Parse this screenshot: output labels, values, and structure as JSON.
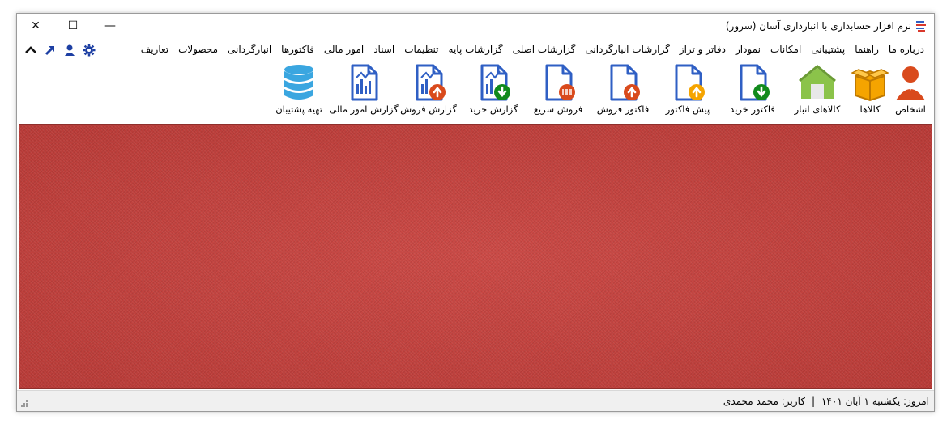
{
  "window": {
    "title": "نرم افزار حسابداری با انبارداری آسان (سرور)",
    "close_glyph": "✕",
    "maximize_glyph": "☐",
    "minimize_glyph": "—"
  },
  "menu": {
    "items": [
      {
        "label": "تعاریف"
      },
      {
        "label": "محصولات"
      },
      {
        "label": "انبارگردانی"
      },
      {
        "label": "فاکتورها"
      },
      {
        "label": "امور مالی"
      },
      {
        "label": "اسناد"
      },
      {
        "label": "تنظیمات"
      },
      {
        "label": "گزارشات پایه"
      },
      {
        "label": "گزارشات اصلی"
      },
      {
        "label": "گزارشات انبارگردانی"
      },
      {
        "label": "دفاتر و تراز"
      },
      {
        "label": "نمودار"
      },
      {
        "label": "امکانات"
      },
      {
        "label": "پشتیبانی"
      },
      {
        "label": "راهنما"
      },
      {
        "label": "درباره ما"
      }
    ],
    "tools": [
      "gear-icon",
      "user-icon",
      "arrow-up-right-icon",
      "chevron-up-icon"
    ]
  },
  "toolbar": {
    "items": [
      {
        "label": "اشخاص",
        "icon": "person-icon"
      },
      {
        "label": "کالاها",
        "icon": "box-icon"
      },
      {
        "label": "کالاهای انبار",
        "icon": "warehouse-icon"
      },
      {
        "label": "فاکتور خرید",
        "icon": "invoice-down-icon"
      },
      {
        "label": "پیش فاکتور",
        "icon": "proforma-icon"
      },
      {
        "label": "فاکتور فروش",
        "icon": "invoice-up-icon"
      },
      {
        "label": "فروش سریع",
        "icon": "barcode-doc-icon"
      },
      {
        "label": "گزارش خرید",
        "icon": "report-down-icon"
      },
      {
        "label": "گزارش فروش",
        "icon": "report-up-icon"
      },
      {
        "label": "گزارش امور مالی",
        "icon": "report-chart-icon"
      },
      {
        "label": "تهیه پشتیبان",
        "icon": "database-icon"
      }
    ]
  },
  "status": {
    "date": "امروز: یکشنبه ۱ آبان ۱۴۰۱",
    "separator": "|",
    "user": "کاربر: محمد محمدی"
  },
  "colors": {
    "background": "#c8403c",
    "icon_blue": "#2f5fc4",
    "orange": "#f5a400",
    "green": "#118a1c",
    "red": "#d94a1c"
  }
}
